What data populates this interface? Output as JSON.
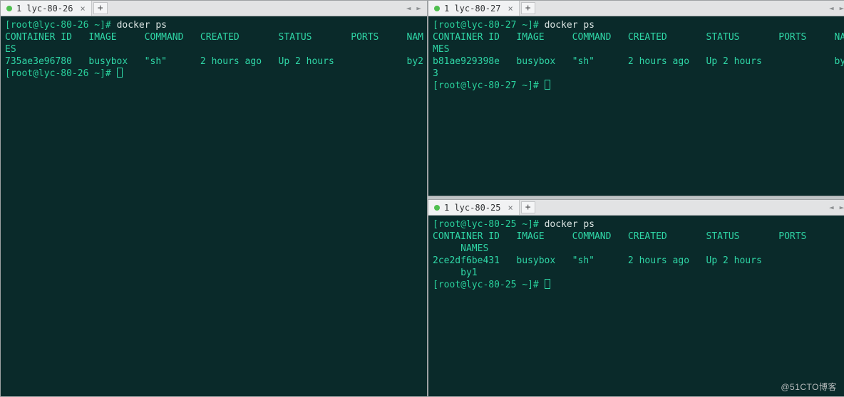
{
  "watermark": "@51CTO博客",
  "panes": {
    "left": {
      "tab": {
        "title": "1 lyc-80-26",
        "active": true
      },
      "prompt": {
        "user": "root",
        "host": "lyc-80-26",
        "path": "~",
        "symbol": "#"
      },
      "command": "docker ps",
      "header": "CONTAINER ID   IMAGE     COMMAND   CREATED       STATUS       PORTS     NAM",
      "header_wrap": "ES",
      "row": "735ae3e96780   busybox   \"sh\"      2 hours ago   Up 2 hours             by2",
      "prompt2": {
        "user": "root",
        "host": "lyc-80-26",
        "path": "~",
        "symbol": "#"
      }
    },
    "top": {
      "tab": {
        "title": "1 lyc-80-27",
        "active": true
      },
      "prompt": {
        "user": "root",
        "host": "lyc-80-27",
        "path": "~",
        "symbol": "#"
      },
      "command": "docker ps",
      "header": "CONTAINER ID   IMAGE     COMMAND   CREATED       STATUS       PORTS     NA",
      "header_wrap": "MES",
      "row": "b81ae929398e   busybox   \"sh\"      2 hours ago   Up 2 hours             by",
      "row_wrap": "3",
      "prompt2": {
        "user": "root",
        "host": "lyc-80-27",
        "path": "~",
        "symbol": "#"
      }
    },
    "bottom": {
      "tab": {
        "title": "1 lyc-80-25",
        "active": true
      },
      "prompt": {
        "user": "root",
        "host": "lyc-80-25",
        "path": "~",
        "symbol": "#"
      },
      "command": "docker ps",
      "header": "CONTAINER ID   IMAGE     COMMAND   CREATED       STATUS       PORTS",
      "header_wrap": "     NAMES",
      "row": "2ce2df6be431   busybox   \"sh\"      2 hours ago   Up 2 hours",
      "row_wrap": "     by1",
      "prompt2": {
        "user": "root",
        "host": "lyc-80-25",
        "path": "~",
        "symbol": "#"
      }
    }
  },
  "ui": {
    "add_tab": "+",
    "close_tab": "×",
    "nav_prev": "◄",
    "nav_next": "►"
  }
}
